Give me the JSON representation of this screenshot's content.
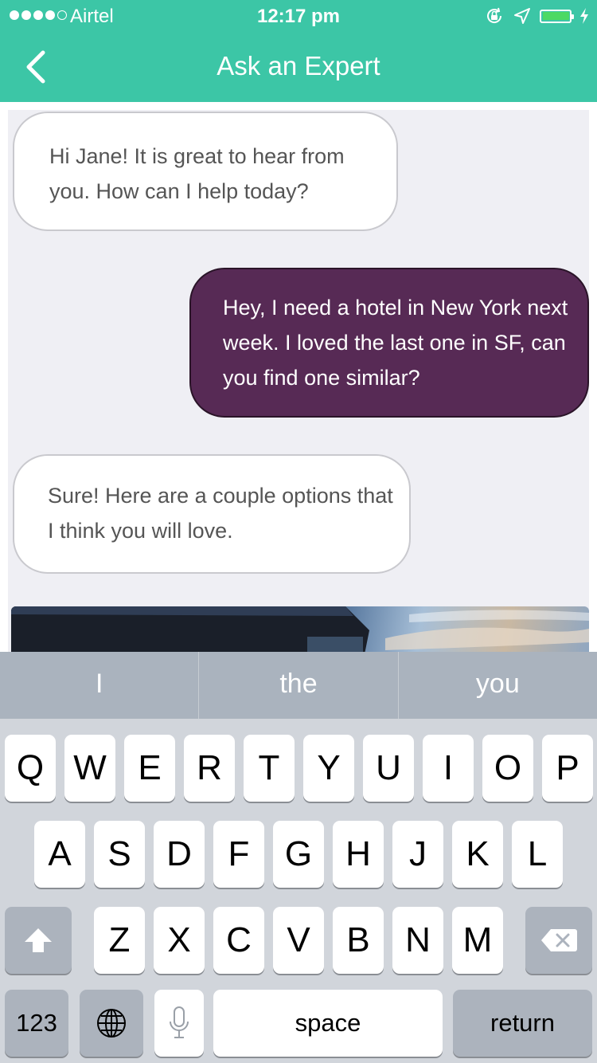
{
  "status_bar": {
    "carrier": "Airtel",
    "time": "12:17 pm",
    "signal_bars": 4,
    "signal_total": 5,
    "icons": [
      "orientation-lock-icon",
      "location-arrow-icon",
      "battery-icon",
      "charging-bolt-icon"
    ],
    "battery_level": 1.0
  },
  "nav": {
    "back_icon": "chevron-left-icon",
    "title": "Ask an Expert"
  },
  "chat": {
    "messages": [
      {
        "direction": "incoming",
        "text": "Hi Jane! It is great to hear from you. How can I help today?"
      },
      {
        "direction": "outgoing",
        "text": "Hey, I need a hotel in New York next week. I loved the last one in SF, can you find one similar?"
      },
      {
        "direction": "incoming",
        "text": "Sure! Here are a couple options that I think you will love."
      }
    ]
  },
  "keyboard": {
    "suggestions": [
      "I",
      "the",
      "you"
    ],
    "row1": [
      "Q",
      "W",
      "E",
      "R",
      "T",
      "Y",
      "U",
      "I",
      "O",
      "P"
    ],
    "row2": [
      "A",
      "S",
      "D",
      "F",
      "G",
      "H",
      "J",
      "K",
      "L"
    ],
    "row3": [
      "Z",
      "X",
      "C",
      "V",
      "B",
      "N",
      "M"
    ],
    "numbers_label": "123",
    "space_label": "space",
    "return_label": "return",
    "shift_icon": "shift-arrow-icon",
    "delete_icon": "backspace-icon",
    "globe_icon": "globe-icon",
    "mic_icon": "microphone-icon"
  },
  "colors": {
    "accent": "#3cc6a6",
    "outgoing_bubble": "#572a55",
    "chat_background": "#efeff4"
  }
}
